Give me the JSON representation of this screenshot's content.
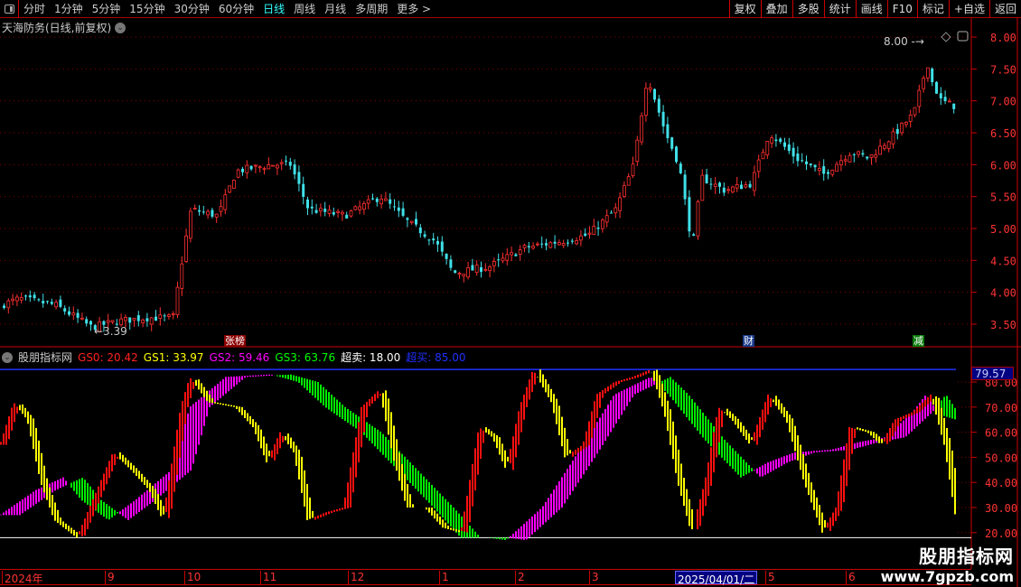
{
  "toolbar": {
    "periods": [
      "分时",
      "1分钟",
      "5分钟",
      "15分钟",
      "30分钟",
      "60分钟",
      "日线",
      "周线",
      "月线",
      "多周期",
      "更多 >"
    ],
    "active_period": "日线",
    "buttons": [
      "复权",
      "叠加",
      "多股",
      "统计",
      "画线",
      "F10",
      "标记",
      "+自选",
      "返回"
    ]
  },
  "main": {
    "title": "天海防务(日线,前复权)",
    "high_label": "8.00",
    "low_label": "3.39",
    "price_axis": [
      "8.00",
      "7.50",
      "7.00",
      "6.50",
      "6.00",
      "5.50",
      "5.00",
      "4.50",
      "4.00",
      "3.50"
    ],
    "markers": [
      {
        "text": "张榜",
        "color": "#8b0000"
      },
      {
        "text": "财",
        "color": "#1a3a8a"
      },
      {
        "text": "减",
        "color": "#0a7a0a"
      }
    ]
  },
  "indicator": {
    "name": "股朋指标网",
    "legend": [
      {
        "label": "GS0: 20.42",
        "color": "#ff2020"
      },
      {
        "label": "GS1: 33.97",
        "color": "#ffff00"
      },
      {
        "label": "GS2: 59.46",
        "color": "#ff00ff"
      },
      {
        "label": "GS3: 63.76",
        "color": "#00ff00"
      },
      {
        "label": "超卖: 18.00",
        "color": "#ffffff"
      },
      {
        "label": "超买: 85.00",
        "color": "#2030ff"
      }
    ],
    "axis": [
      "80.00",
      "70.00",
      "60.00",
      "50.00",
      "40.00",
      "30.00",
      "20.00"
    ],
    "current_value": "79.57",
    "overbought": 85,
    "oversold": 18
  },
  "dates": {
    "labels": [
      "2024年",
      "9",
      "10",
      "11",
      "12",
      "1",
      "2",
      "3",
      "5",
      "6"
    ],
    "current": "2025/04/01/二"
  },
  "watermark": {
    "line1": "股朋指标网",
    "line2": "www.7gpzb.com"
  },
  "chart_data": {
    "type": "candlestick",
    "price_keypoints": [
      [
        0,
        3.8
      ],
      [
        20,
        3.9
      ],
      [
        60,
        3.8
      ],
      [
        100,
        3.45
      ],
      [
        130,
        3.55
      ],
      [
        160,
        3.6
      ],
      [
        190,
        3.6
      ],
      [
        200,
        4.5
      ],
      [
        210,
        5.3
      ],
      [
        240,
        5.2
      ],
      [
        260,
        5.9
      ],
      [
        300,
        6.0
      ],
      [
        320,
        6.0
      ],
      [
        340,
        5.3
      ],
      [
        380,
        5.2
      ],
      [
        420,
        5.5
      ],
      [
        450,
        5.1
      ],
      [
        480,
        4.8
      ],
      [
        500,
        4.3
      ],
      [
        540,
        4.4
      ],
      [
        580,
        4.7
      ],
      [
        620,
        4.8
      ],
      [
        650,
        4.9
      ],
      [
        680,
        5.3
      ],
      [
        700,
        6.0
      ],
      [
        715,
        7.4
      ],
      [
        735,
        6.5
      ],
      [
        750,
        6.0
      ],
      [
        765,
        4.7
      ],
      [
        775,
        5.8
      ],
      [
        800,
        5.6
      ],
      [
        830,
        5.7
      ],
      [
        850,
        6.5
      ],
      [
        880,
        6.1
      ],
      [
        910,
        5.85
      ],
      [
        940,
        6.2
      ],
      [
        960,
        6.1
      ],
      [
        990,
        6.5
      ],
      [
        1010,
        6.8
      ],
      [
        1025,
        7.6
      ],
      [
        1030,
        7.3
      ],
      [
        1040,
        7.0
      ],
      [
        1058,
        6.9
      ]
    ],
    "slow_keypoints": [
      [
        0,
        27
      ],
      [
        40,
        37
      ],
      [
        70,
        42
      ],
      [
        90,
        33
      ],
      [
        120,
        25
      ],
      [
        150,
        33
      ],
      [
        190,
        45
      ],
      [
        210,
        70
      ],
      [
        250,
        82
      ],
      [
        300,
        83
      ],
      [
        330,
        80
      ],
      [
        360,
        70
      ],
      [
        400,
        60
      ],
      [
        440,
        45
      ],
      [
        480,
        30
      ],
      [
        510,
        18
      ],
      [
        540,
        18
      ],
      [
        560,
        17
      ],
      [
        600,
        30
      ],
      [
        640,
        52
      ],
      [
        680,
        75
      ],
      [
        720,
        82
      ],
      [
        740,
        75
      ],
      [
        780,
        57
      ],
      [
        820,
        42
      ],
      [
        850,
        48
      ],
      [
        880,
        52
      ],
      [
        920,
        53
      ],
      [
        950,
        56
      ],
      [
        980,
        58
      ],
      [
        1010,
        68
      ],
      [
        1025,
        75
      ],
      [
        1040,
        67
      ],
      [
        1058,
        65
      ]
    ],
    "fast_keypoints": [
      [
        0,
        55
      ],
      [
        15,
        72
      ],
      [
        30,
        65
      ],
      [
        45,
        40
      ],
      [
        60,
        25
      ],
      [
        85,
        18
      ],
      [
        105,
        35
      ],
      [
        125,
        52
      ],
      [
        145,
        45
      ],
      [
        165,
        37
      ],
      [
        180,
        25
      ],
      [
        200,
        70
      ],
      [
        210,
        82
      ],
      [
        230,
        72
      ],
      [
        260,
        70
      ],
      [
        280,
        62
      ],
      [
        295,
        48
      ],
      [
        310,
        60
      ],
      [
        325,
        52
      ],
      [
        340,
        25
      ],
      [
        360,
        28
      ],
      [
        380,
        30
      ],
      [
        400,
        70
      ],
      [
        420,
        77
      ],
      [
        435,
        50
      ],
      [
        450,
        30
      ],
      [
        470,
        30
      ],
      [
        490,
        22
      ],
      [
        510,
        20
      ],
      [
        530,
        62
      ],
      [
        545,
        58
      ],
      [
        560,
        45
      ],
      [
        575,
        70
      ],
      [
        590,
        85
      ],
      [
        610,
        72
      ],
      [
        625,
        50
      ],
      [
        645,
        55
      ],
      [
        660,
        75
      ],
      [
        680,
        80
      ],
      [
        700,
        82
      ],
      [
        720,
        85
      ],
      [
        735,
        68
      ],
      [
        750,
        40
      ],
      [
        765,
        20
      ],
      [
        780,
        40
      ],
      [
        795,
        70
      ],
      [
        810,
        65
      ],
      [
        830,
        55
      ],
      [
        850,
        75
      ],
      [
        870,
        65
      ],
      [
        890,
        40
      ],
      [
        910,
        20
      ],
      [
        925,
        30
      ],
      [
        940,
        62
      ],
      [
        960,
        60
      ],
      [
        975,
        55
      ],
      [
        990,
        65
      ],
      [
        1010,
        68
      ],
      [
        1030,
        75
      ],
      [
        1045,
        55
      ],
      [
        1058,
        25
      ]
    ]
  }
}
